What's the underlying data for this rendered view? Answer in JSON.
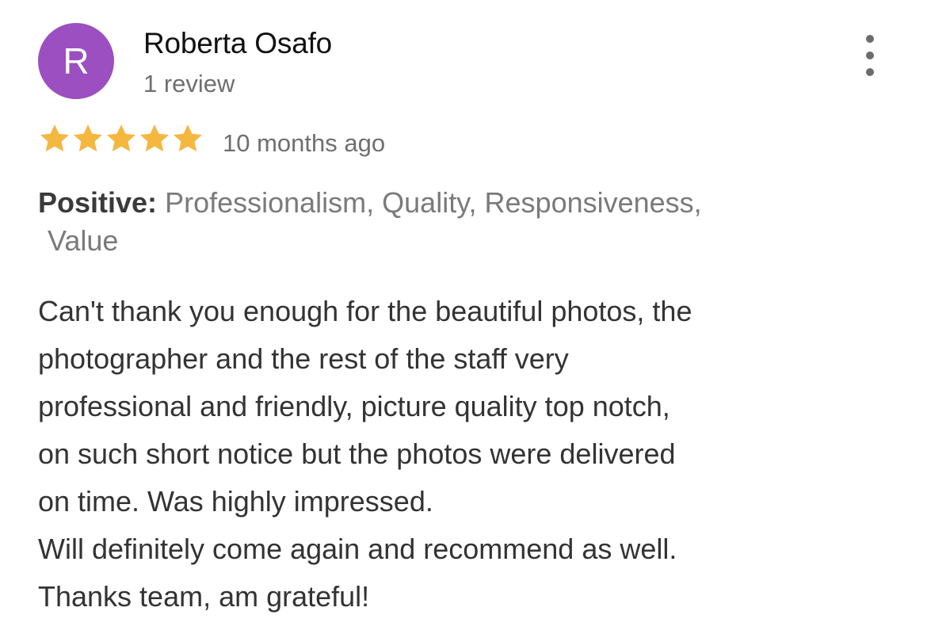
{
  "reviewer": {
    "avatar_initial": "R",
    "avatar_color": "#9b4fc0",
    "name": "Roberta Osafo",
    "review_count": "1 review"
  },
  "menu": {
    "icon": "more-vertical-icon"
  },
  "rating": {
    "stars": 5,
    "max_stars": 5,
    "star_color": "#f4b740",
    "timestamp": "10 months ago"
  },
  "highlights": {
    "label": "Positive:",
    "line1": "Professionalism, Quality, Responsiveness,",
    "line2": "Value"
  },
  "review_text": {
    "lines": [
      "Can't thank you enough for the beautiful photos, the",
      "photographer and the rest of the staff very",
      "professional and friendly, picture quality top notch,",
      "on such short notice but the photos were delivered",
      "on time. Was highly impressed.",
      "Will definitely come again and recommend as well.",
      "Thanks team, am grateful!"
    ]
  }
}
